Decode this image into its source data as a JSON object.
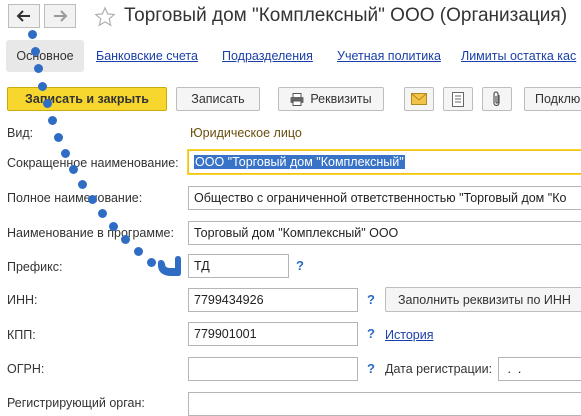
{
  "window": {
    "title": "Торговый дом \"Комплексный\" ООО (Организация)"
  },
  "tabs": [
    {
      "label": "Основное",
      "active": true
    },
    {
      "label": "Банковские счета"
    },
    {
      "label": "Подразделения"
    },
    {
      "label": "Учетная политика"
    },
    {
      "label": "Лимиты остатка кас"
    }
  ],
  "toolbar": {
    "save_close": "Записать и закрыть",
    "save": "Записать",
    "requisites": "Реквизиты",
    "connect": "Подклю"
  },
  "form": {
    "vid": {
      "label": "Вид:",
      "value": "Юридическое лицо"
    },
    "short_name": {
      "label": "Сокращенное наименование:",
      "value": "ООО \"Торговый дом \"Комплексный\""
    },
    "full_name": {
      "label": "Полное наименование:",
      "value": "Общество с ограниченной ответственностью \"Торговый дом \"Ко"
    },
    "program_name": {
      "label": "Наименование в программе:",
      "value": "Торговый дом \"Комплексный\" ООО"
    },
    "prefix": {
      "label": "Префикс:",
      "value": "ТД"
    },
    "inn": {
      "label": "ИНН:",
      "value": "7799434926"
    },
    "fill_button": "Заполнить реквизиты по ИНН",
    "kpp": {
      "label": "КПП:",
      "value": "779901001"
    },
    "history_link": "История",
    "ogrn": {
      "label": "ОГРН:",
      "value": ""
    },
    "reg_date": {
      "label": "Дата регистрации:",
      "value": " .  ."
    },
    "reg_organ": {
      "label": "Регистрирующий орган:"
    },
    "help_mark": "?"
  },
  "colors": {
    "accent_yellow": "#f7d72e",
    "link_blue": "#1a3fa8",
    "annotation_blue": "#2f6cc4",
    "selection_blue": "#3873c8"
  }
}
